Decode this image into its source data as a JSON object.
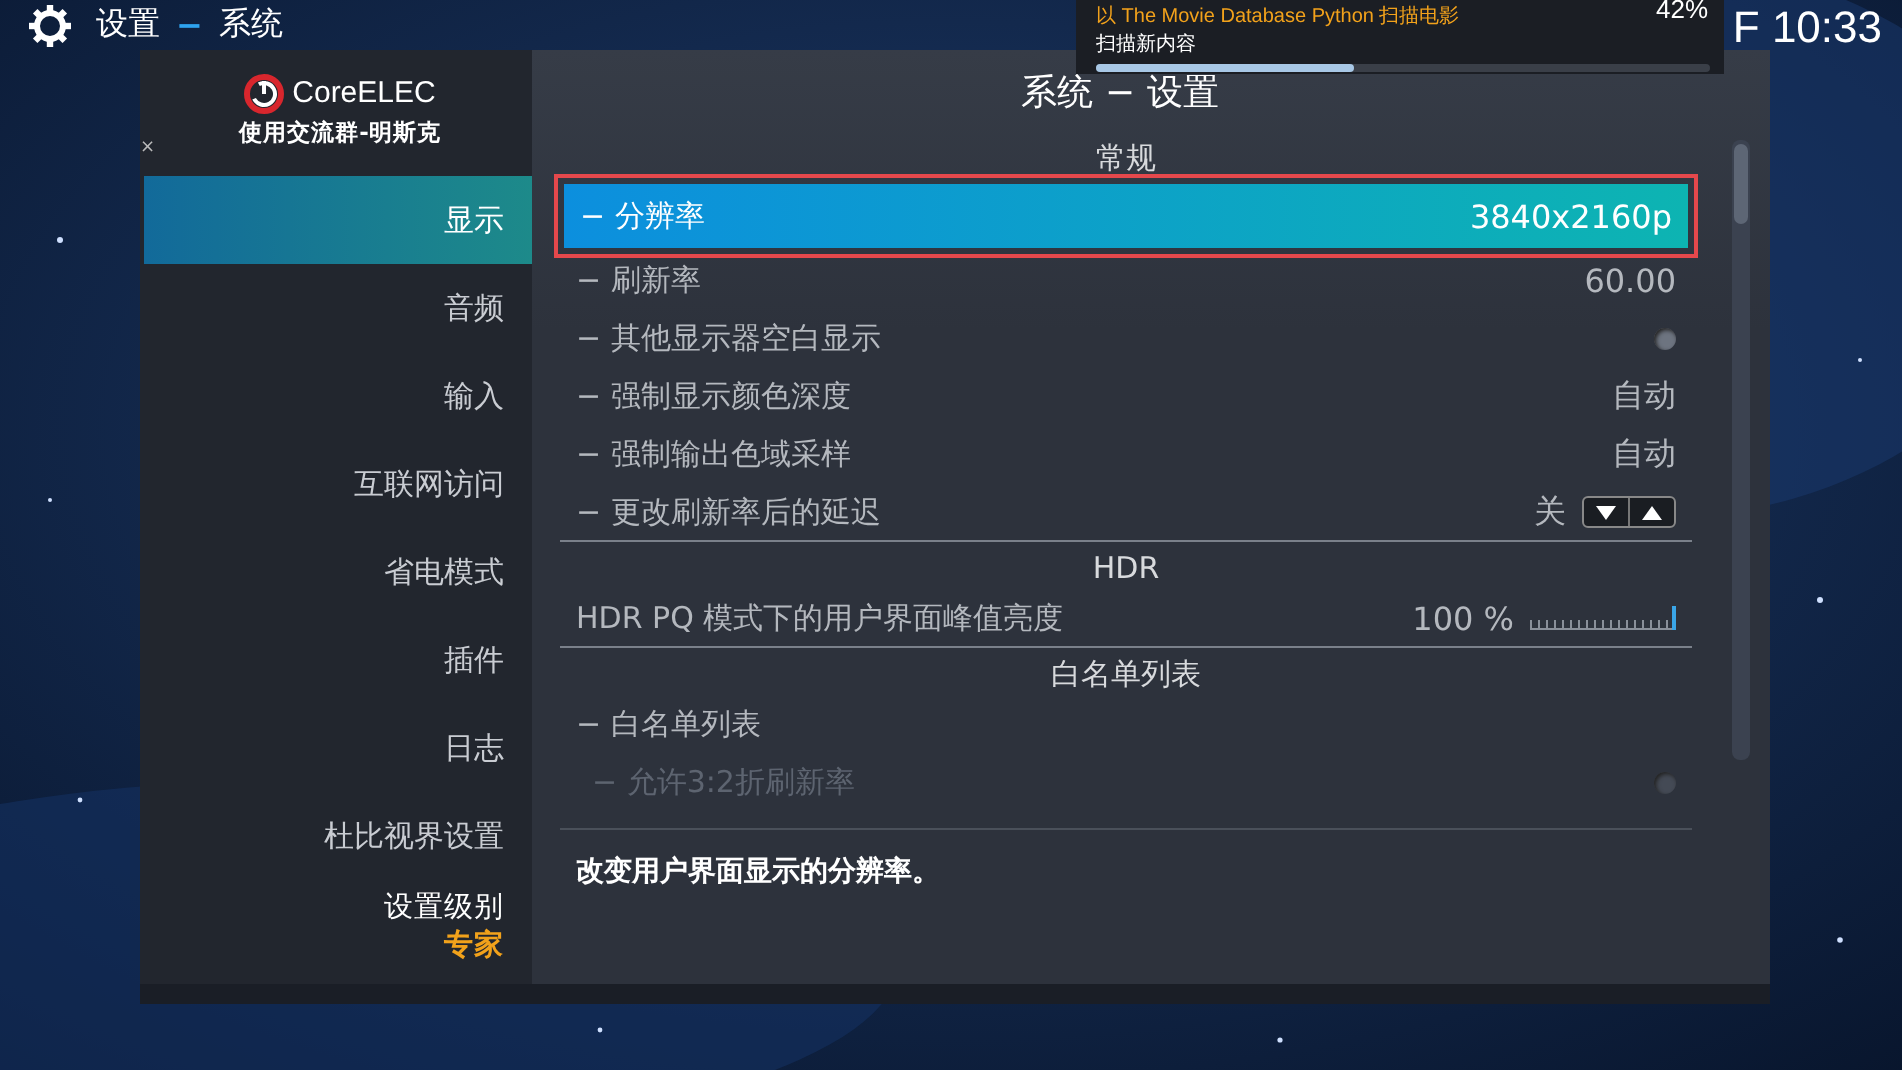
{
  "header": {
    "breadcrumb": [
      "设置",
      "−",
      "系统"
    ],
    "clock": "F 10:33"
  },
  "notification": {
    "title": "以 The Movie Database Python 扫描电影",
    "message": "扫描新内容",
    "percent": "42%",
    "level": 0.42
  },
  "sidebar": {
    "logo": "CoreELEC",
    "subtitle": "使用交流群-明斯克",
    "close_mark": "×",
    "items": [
      {
        "label": "显示",
        "selected": true
      },
      {
        "label": "音频",
        "selected": false
      },
      {
        "label": "输入",
        "selected": false
      },
      {
        "label": "互联网访问",
        "selected": false
      },
      {
        "label": "省电模式",
        "selected": false
      },
      {
        "label": "插件",
        "selected": false
      },
      {
        "label": "日志",
        "selected": false
      },
      {
        "label": "杜比视界设置",
        "selected": false
      }
    ],
    "level_label": "设置级别",
    "level_value": "专家"
  },
  "content": {
    "title": "系统 − 设置",
    "settings": [
      {
        "kind": "section",
        "label": "常规"
      },
      {
        "kind": "value",
        "label": "− 分辨率",
        "value": "3840x2160p",
        "selected": true,
        "disabled": false
      },
      {
        "kind": "value",
        "label": "− 刷新率",
        "value": "60.00",
        "selected": false,
        "disabled": false
      },
      {
        "kind": "toggle",
        "label": "− 其他显示器空白显示",
        "on": false,
        "selected": false,
        "disabled": false
      },
      {
        "kind": "value",
        "label": "− 强制显示颜色深度",
        "value": "自动",
        "selected": false,
        "disabled": false
      },
      {
        "kind": "value",
        "label": "− 强制输出色域采样",
        "value": "自动",
        "selected": false,
        "disabled": false
      },
      {
        "kind": "spinner",
        "label": "− 更改刷新率后的延迟",
        "value": "关",
        "selected": false,
        "disabled": false
      },
      {
        "kind": "section",
        "label": "HDR"
      },
      {
        "kind": "slider",
        "label": "HDR PQ 模式下的用户界面峰值亮度",
        "value": "100 %",
        "level": 1,
        "selected": false,
        "disabled": false
      },
      {
        "kind": "section",
        "label": "白名单列表"
      },
      {
        "kind": "value",
        "label": "− 白名单列表",
        "selected": false,
        "disabled": false
      },
      {
        "kind": "toggle",
        "label": "− 允许3:2折刷新率",
        "on": false,
        "selected": false,
        "disabled": true
      }
    ],
    "description": "改变用户界面显示的分辨率。"
  }
}
